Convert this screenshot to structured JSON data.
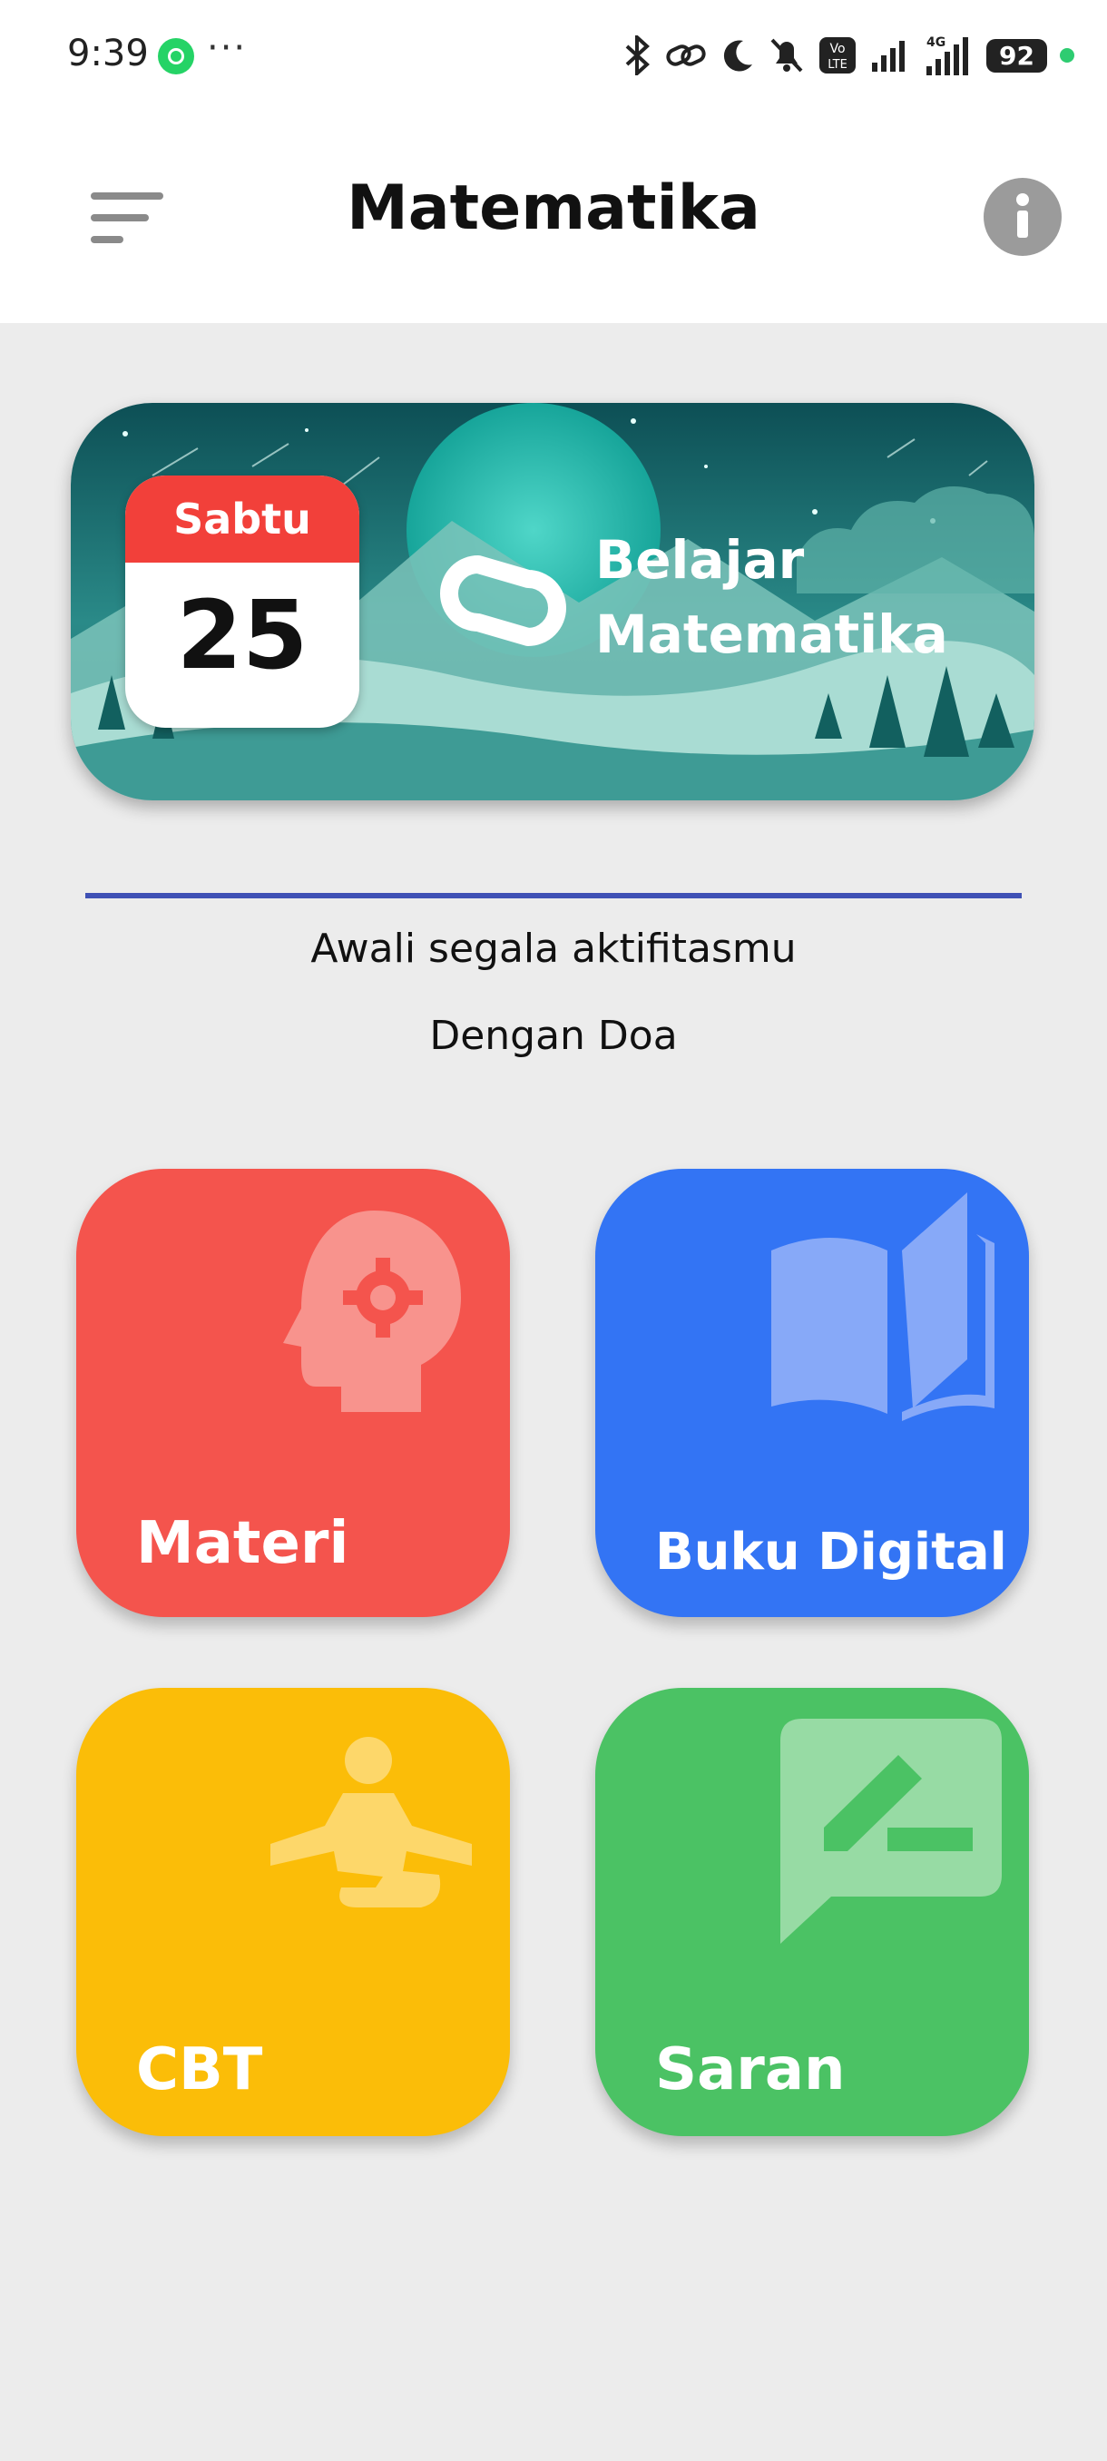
{
  "status_bar": {
    "time": "9:39",
    "battery": "92",
    "icons": [
      "whatsapp-icon",
      "more-icon",
      "bluetooth-icon",
      "link-icon",
      "moon-icon",
      "bell-off-icon",
      "volte-icon",
      "signal-icon",
      "signal-4g-icon",
      "battery-icon"
    ]
  },
  "app_bar": {
    "title": "Matematika",
    "menu_icon": "menu-icon",
    "info_icon": "info-icon"
  },
  "banner": {
    "day": "Sabtu",
    "date": "25",
    "line1": "Belajar",
    "line2": "Matematika"
  },
  "greeting": {
    "line1": "Awali segala aktifitasmu",
    "line2": "Dengan Doa"
  },
  "tiles": [
    {
      "label": "Materi",
      "icon": "head-gear-icon",
      "color": "#f4544d"
    },
    {
      "label": "Buku Digital",
      "icon": "open-book-icon",
      "color": "#3374f4"
    },
    {
      "label": "CBT",
      "icon": "meditation-icon",
      "color": "#fbbd08"
    },
    {
      "label": "Saran",
      "icon": "feedback-edit-icon",
      "color": "#4bc264"
    }
  ],
  "colors": {
    "divider": "#3f51b5",
    "calendar_header": "#f2403a"
  }
}
